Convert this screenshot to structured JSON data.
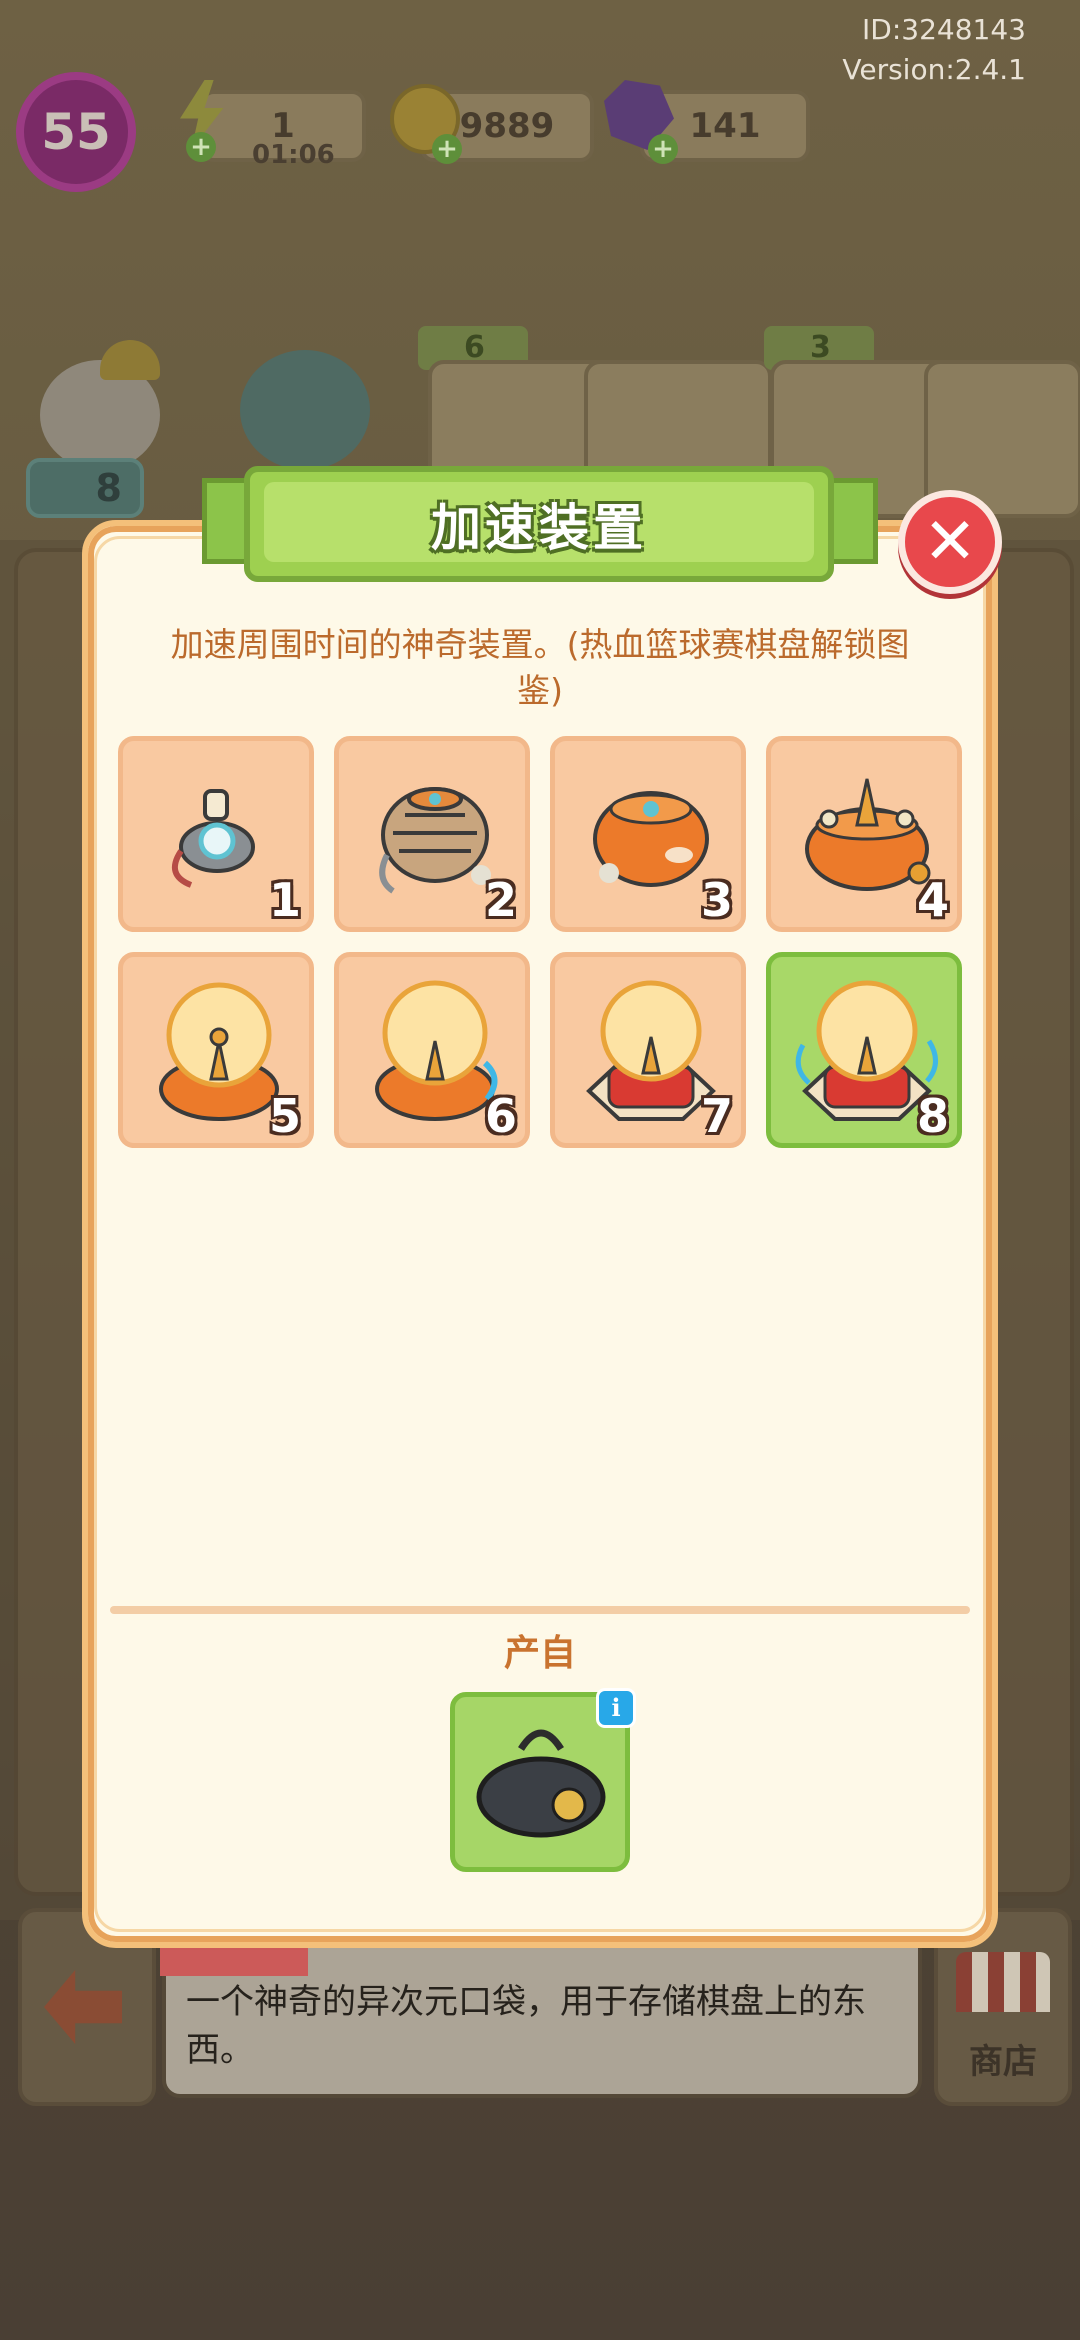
{
  "meta": {
    "player_id": "ID:3248143",
    "version": "Version:2.4.1"
  },
  "hud": {
    "level": "55",
    "energy": "1",
    "energy_timer": "01:06",
    "coins": "9889",
    "gems": "141"
  },
  "background": {
    "orders": [
      {
        "stars": "6"
      },
      {
        "stars": "3"
      }
    ],
    "helper_count": "8"
  },
  "modal": {
    "title": "加速装置",
    "description": "加速周围时间的神奇装置。(热血篮球赛棋盘解锁图鉴)",
    "items": [
      {
        "level": "1",
        "unlocked": true
      },
      {
        "level": "2",
        "unlocked": true
      },
      {
        "level": "3",
        "unlocked": true
      },
      {
        "level": "4",
        "unlocked": true
      },
      {
        "level": "5",
        "unlocked": true
      },
      {
        "level": "6",
        "unlocked": true
      },
      {
        "level": "7",
        "unlocked": true
      },
      {
        "level": "8",
        "unlocked": true,
        "current": true
      }
    ],
    "source_label": "产自",
    "source_item_icon": "duffel-bag-icon",
    "info_symbol": "i",
    "close_symbol": "✕"
  },
  "bottom_bar": {
    "description": "一个神奇的异次元口袋，用于存储棋盘上的东西。",
    "shop_label": "商店"
  },
  "colors": {
    "accent_green": "#9ed050",
    "close_red": "#e8484c",
    "tile_peach": "#f9c9a1"
  }
}
